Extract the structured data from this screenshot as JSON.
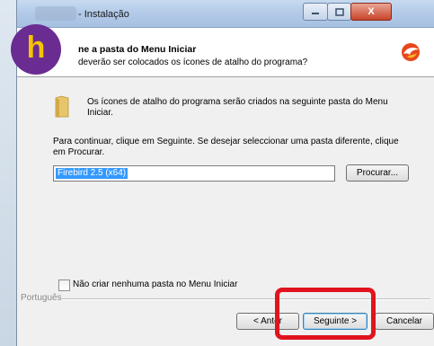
{
  "window": {
    "title": "- Instalação",
    "close_glyph": "X"
  },
  "header": {
    "title": "ne a pasta do Menu Iniciar",
    "subtitle": "deverão ser colocados os ícones de atalho do programa?"
  },
  "content": {
    "info_text": "Os ícones de atalho do programa serão criados na seguinte pasta do Menu Iniciar.",
    "instructions": "Para continuar, clique em Seguinte. Se desejar seleccionar uma pasta diferente, clique em Procurar.",
    "folder_value": "Firebird 2.5 (x64)",
    "browse_label": "Procurar...",
    "no_folder_checkbox_label": "Não criar nenhuma pasta no Menu Iniciar"
  },
  "footer": {
    "language": "Português",
    "back_label": "< Anter",
    "next_label": "Seguinte >",
    "cancel_label": "Cancelar"
  },
  "overlay": {
    "logo_letter": "h",
    "logo_color": "#6a2c91",
    "logo_letter_color": "#f5c400",
    "highlight_color": "#e0141e"
  },
  "icons": {
    "app_logo": "firebird-logo-icon",
    "folder": "folder-icon"
  }
}
